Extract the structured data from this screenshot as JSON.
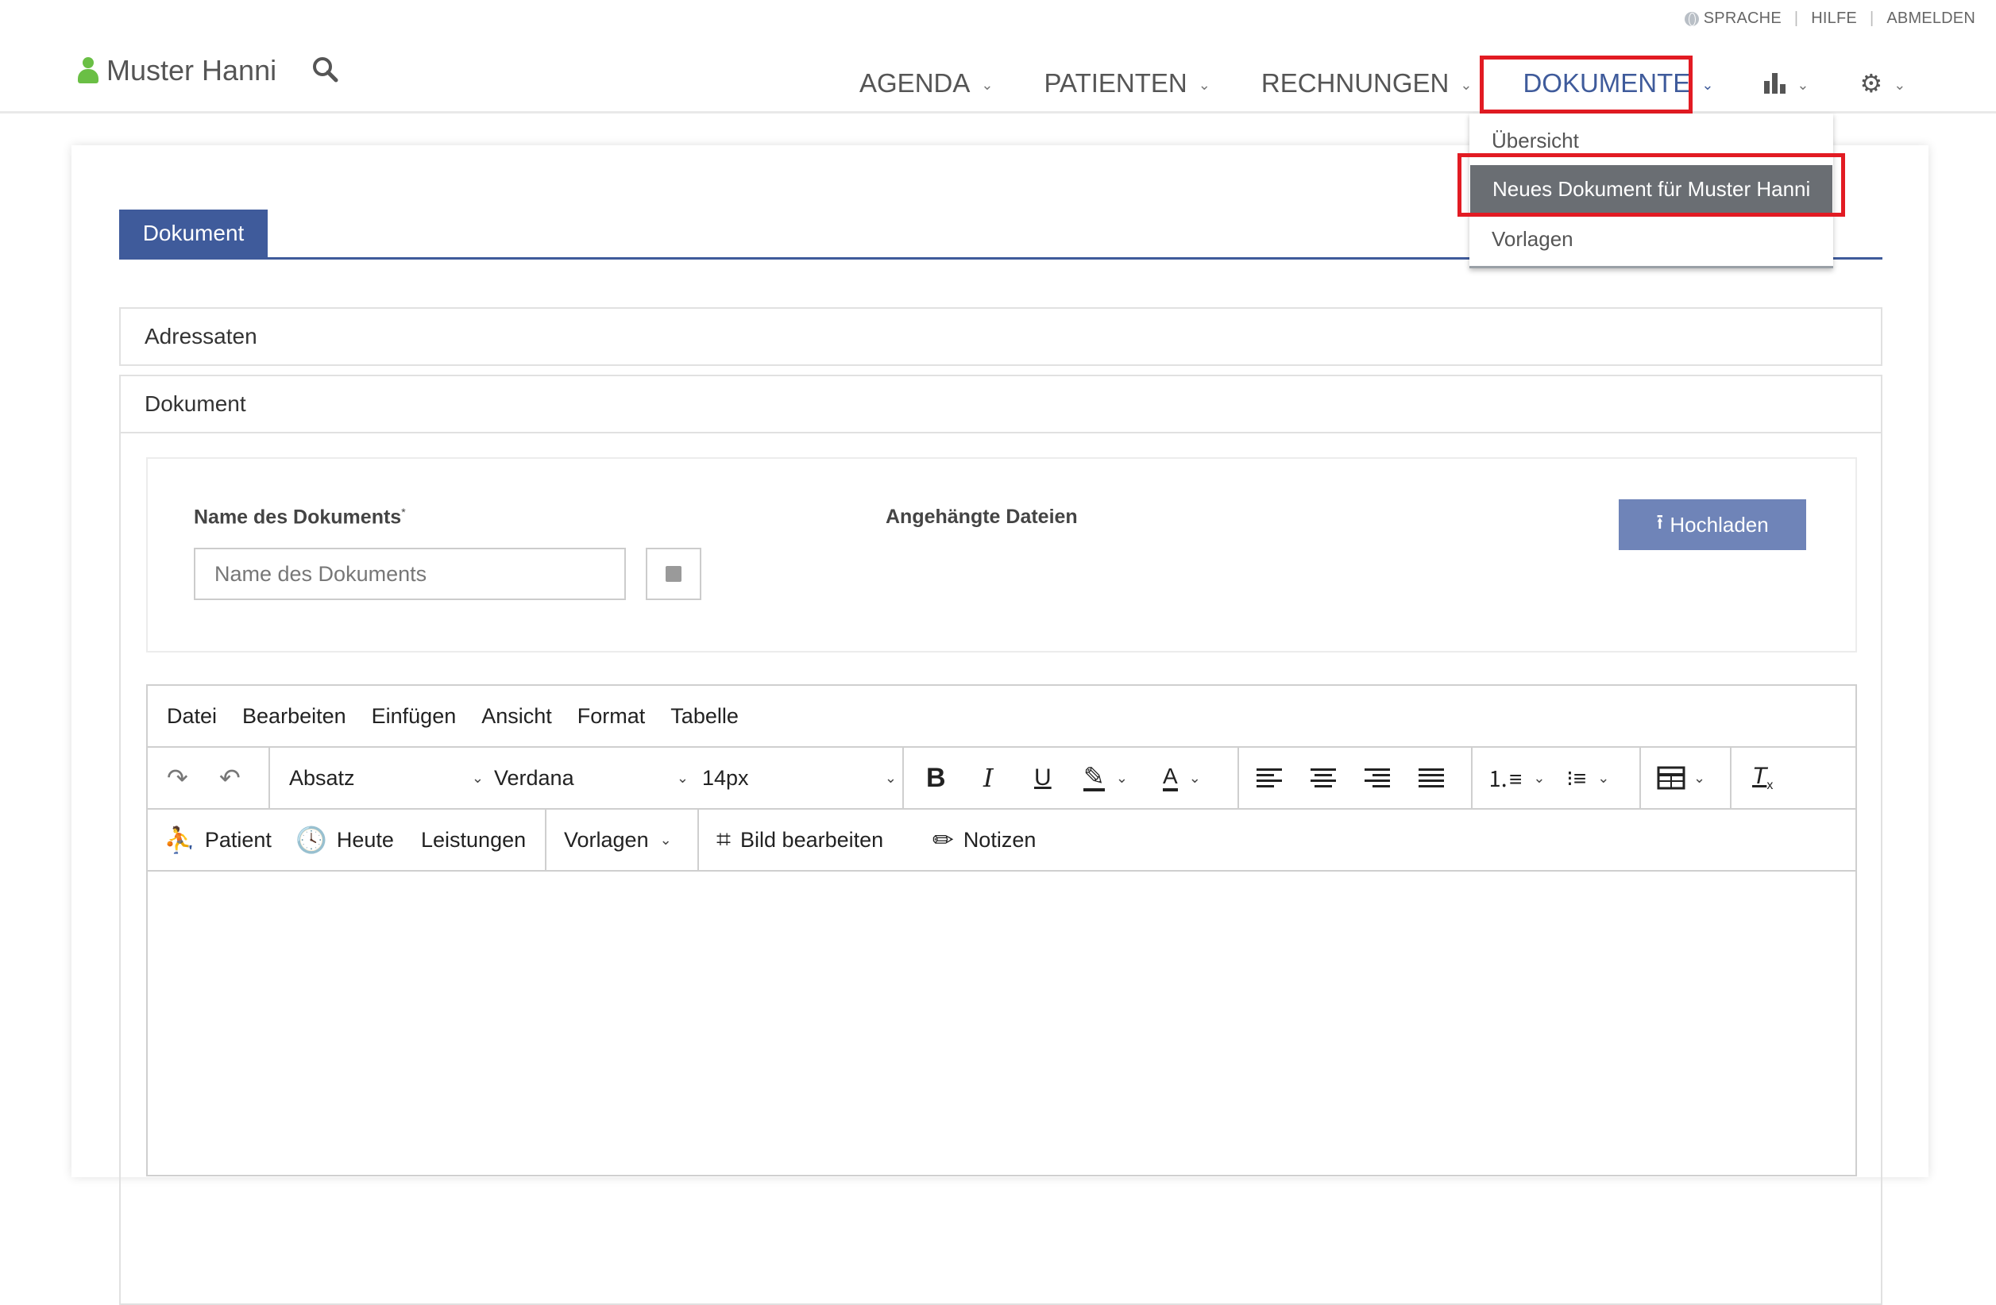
{
  "utility": {
    "language": "SPRACHE",
    "help": "HILFE",
    "logout": "ABMELDEN"
  },
  "header": {
    "user_name": "Muster Hanni"
  },
  "nav": {
    "agenda": "AGENDA",
    "patients": "PATIENTEN",
    "invoices": "RECHNUNGEN",
    "documents": "DOKUMENTE"
  },
  "dropdown": {
    "items": [
      "Übersicht",
      "Neues Dokument für Muster Hanni",
      "Vorlagen"
    ]
  },
  "tabs": {
    "document": "Dokument"
  },
  "panels": {
    "recipients": "Adressaten",
    "document": "Dokument"
  },
  "form": {
    "name_label": "Name des Dokuments",
    "required_mark": "*",
    "name_placeholder": "Name des Dokuments",
    "attachments_label": "Angehängte Dateien",
    "upload_button": "Hochladen"
  },
  "editor": {
    "menu": [
      "Datei",
      "Bearbeiten",
      "Einfügen",
      "Ansicht",
      "Format",
      "Tabelle"
    ],
    "block_format": "Absatz",
    "font_family": "Verdana",
    "font_size": "14px",
    "custom": {
      "patient": "Patient",
      "today": "Heute",
      "services": "Leistungen",
      "templates": "Vorlagen",
      "edit_image": "Bild bearbeiten",
      "notes": "Notizen"
    }
  },
  "colors": {
    "primary": "#3f5b9b",
    "highlight": "#e21b23",
    "user_icon": "#6abf45"
  }
}
